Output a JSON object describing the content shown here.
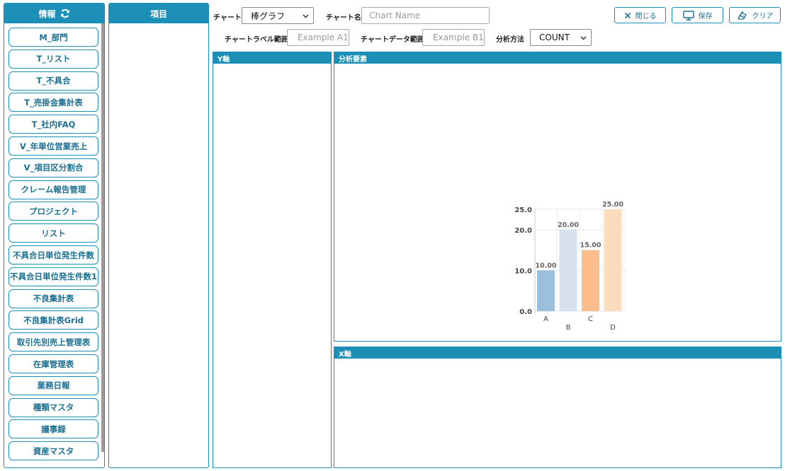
{
  "sidebar": {
    "title": "情報",
    "items": [
      {
        "label": "M_部門"
      },
      {
        "label": "T_リスト"
      },
      {
        "label": "T_不具合"
      },
      {
        "label": "T_売掛金集計表"
      },
      {
        "label": "T_社内FAQ"
      },
      {
        "label": "V_年単位営業売上"
      },
      {
        "label": "V_項目区分割合"
      },
      {
        "label": "クレーム報告管理"
      },
      {
        "label": "プロジェクト"
      },
      {
        "label": "リスト"
      },
      {
        "label": "不具合日単位発生件数"
      },
      {
        "label": "不具合日単位発生件数1"
      },
      {
        "label": "不良集計表"
      },
      {
        "label": "不良集計表Grid"
      },
      {
        "label": "取引先別売上管理表"
      },
      {
        "label": "在庫管理表"
      },
      {
        "label": "業務日報"
      },
      {
        "label": "種類マスタ"
      },
      {
        "label": "議事録"
      },
      {
        "label": "資産マスタ"
      }
    ]
  },
  "items_panel": {
    "title": "項目"
  },
  "toolbar": {
    "chart_label": "チャート",
    "chart_type_value": "棒グラフ",
    "chart_name_label": "チャート名",
    "chart_name_placeholder": "Chart Name",
    "label_range_label": "チャートラベル範囲",
    "label_range_placeholder": "Example A1",
    "data_range_label": "チャートデータ範囲",
    "data_range_placeholder": "Example B1",
    "method_label": "分析方法",
    "method_value": "COUNT",
    "close_label": "閉じる",
    "save_label": "保存",
    "clear_label": "クリア"
  },
  "panels": {
    "y_axis": "Y軸",
    "analysis": "分析要素",
    "x_axis": "X軸"
  },
  "colors": {
    "accent": "#1b8fb6",
    "bar_a": "#9bbfdc",
    "bar_b": "#d6e0ef",
    "bar_c": "#fdbd8a",
    "bar_d": "#fddcbd"
  },
  "chart_data": {
    "type": "bar",
    "categories": [
      "A",
      "B",
      "C",
      "D"
    ],
    "values": [
      10.0,
      20.0,
      15.0,
      25.0
    ],
    "value_labels": [
      "10.00",
      "20.00",
      "15.00",
      "25.00"
    ],
    "y_ticks": [
      "0.0",
      "10.0",
      "20.0",
      "25.0"
    ],
    "ylim": [
      0,
      25
    ],
    "grid": true
  }
}
